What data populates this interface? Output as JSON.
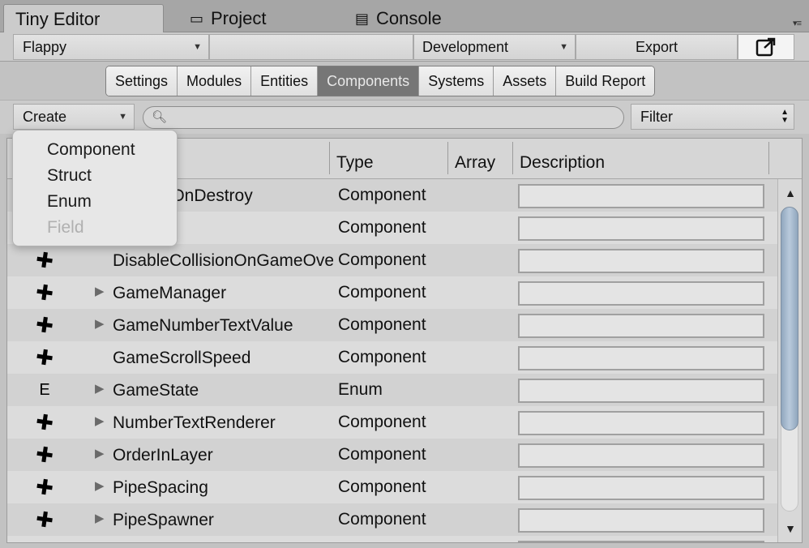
{
  "window": {
    "tabs": [
      {
        "label": "Tiny Editor",
        "icon": ""
      },
      {
        "label": "Project",
        "icon": "folder-icon"
      },
      {
        "label": "Console",
        "icon": "console-icon"
      }
    ],
    "tab_menu_glyph": "▾≡"
  },
  "toolbar": {
    "project": "Flappy",
    "configuration": "Development",
    "export_label": "Export",
    "open_window_icon": "external-window-icon"
  },
  "nav": {
    "tabs": [
      "Settings",
      "Modules",
      "Entities",
      "Components",
      "Systems",
      "Assets",
      "Build Report"
    ],
    "active": "Components"
  },
  "actions": {
    "create_label": "Create",
    "search_placeholder": "",
    "filter_label": "Filter"
  },
  "table": {
    "headers": {
      "name": "",
      "type": "Type",
      "array": "Array",
      "description": "Description"
    },
    "rows": [
      {
        "icon": "puzzle-icon",
        "expandable": false,
        "name": "DestroyOnDestroy",
        "type": "Component"
      },
      {
        "icon": "puzzle-icon",
        "expandable": false,
        "name": "",
        "type": "Component"
      },
      {
        "icon": "puzzle-icon",
        "expandable": false,
        "name": "DisableCollisionOnGameOver",
        "type": "Component"
      },
      {
        "icon": "puzzle-icon",
        "expandable": true,
        "name": "GameManager",
        "type": "Component"
      },
      {
        "icon": "puzzle-icon",
        "expandable": true,
        "name": "GameNumberTextValue",
        "type": "Component"
      },
      {
        "icon": "puzzle-icon",
        "expandable": false,
        "name": "GameScrollSpeed",
        "type": "Component"
      },
      {
        "icon": "enum-icon",
        "expandable": true,
        "name": "GameState",
        "type": "Enum"
      },
      {
        "icon": "puzzle-icon",
        "expandable": true,
        "name": "NumberTextRenderer",
        "type": "Component"
      },
      {
        "icon": "puzzle-icon",
        "expandable": true,
        "name": "OrderInLayer",
        "type": "Component"
      },
      {
        "icon": "puzzle-icon",
        "expandable": true,
        "name": "PipeSpacing",
        "type": "Component"
      },
      {
        "icon": "puzzle-icon",
        "expandable": true,
        "name": "PipeSpawner",
        "type": "Component"
      },
      {
        "icon": "puzzle-icon",
        "expandable": false,
        "name": "",
        "type": ""
      }
    ]
  },
  "create_menu": {
    "items": [
      {
        "label": "Component",
        "enabled": true
      },
      {
        "label": "Struct",
        "enabled": true
      },
      {
        "label": "Enum",
        "enabled": true
      },
      {
        "label": "Field",
        "enabled": false
      }
    ]
  },
  "colors": {
    "active_tab_bg": "#767676",
    "scroll_thumb": "#a7bbd0",
    "background": "#c2c2c2"
  }
}
